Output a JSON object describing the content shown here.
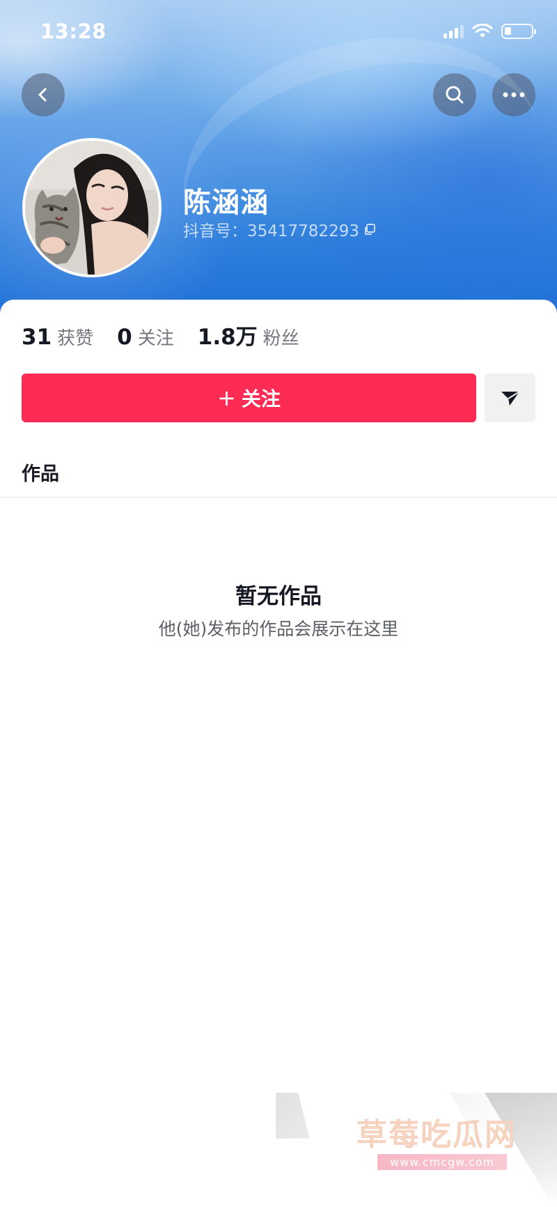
{
  "status_bar": {
    "time": "13:28",
    "icons": [
      "signal-icon",
      "wifi-icon",
      "battery-icon"
    ]
  },
  "nav": {
    "back_icon": "chevron-left-icon",
    "search_icon": "search-icon",
    "more_icon": "more-dots-icon"
  },
  "profile": {
    "name": "陈涵涵",
    "id_label": "抖音号：35417782293",
    "copy_icon": "copy-icon"
  },
  "stats": [
    {
      "value": "31",
      "label": "获赞"
    },
    {
      "value": "0",
      "label": "关注"
    },
    {
      "value": "1.8万",
      "label": "粉丝"
    }
  ],
  "actions": {
    "follow_plus": "+",
    "follow_label": "关注",
    "follow_color": "#fe2c55",
    "share_icon": "send-icon"
  },
  "tabs": {
    "works_label": "作品"
  },
  "empty_state": {
    "title": "暂无作品",
    "subtitle": "他(她)发布的作品会展示在这里"
  },
  "watermark": {
    "text": "草莓吃瓜网",
    "url": "www.cmcgw.com"
  },
  "colors": {
    "accent": "#fe2c55",
    "text_primary": "#161823",
    "text_secondary": "#75777f"
  }
}
